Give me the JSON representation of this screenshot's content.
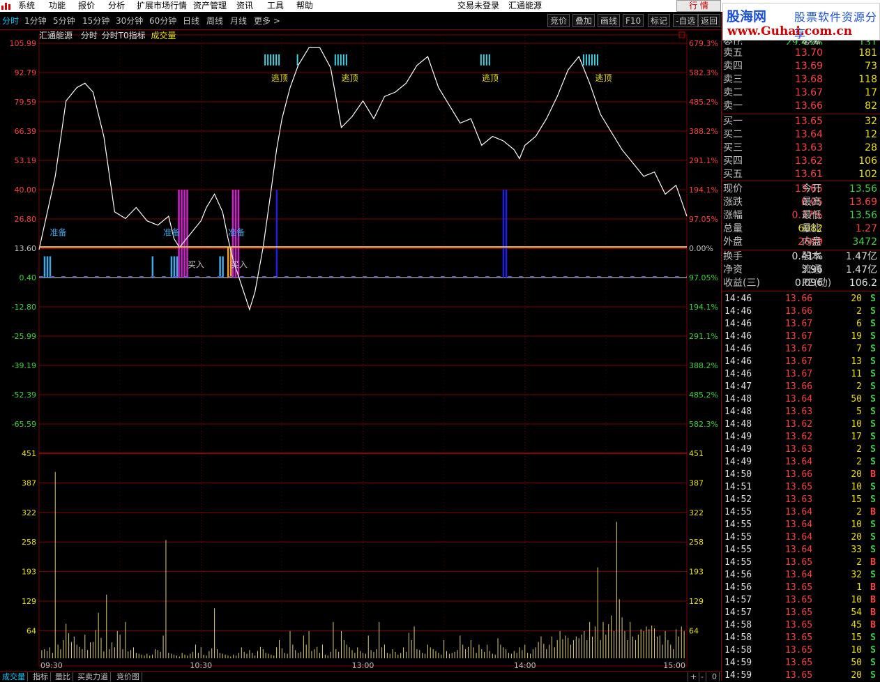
{
  "menu": {
    "items": [
      "系统",
      "功能",
      "报价",
      "分析",
      "扩展市场行情",
      "资产管理",
      "资讯",
      "工具",
      "帮助"
    ],
    "status": "交易未登录",
    "stock_name": "汇通能源",
    "hq_button": "行 情"
  },
  "periods": [
    "分时",
    "1分钟",
    "5分钟",
    "15分钟",
    "30分钟",
    "60分钟",
    "日线",
    "周线",
    "月线",
    "更多 >"
  ],
  "tool_buttons": [
    "竞价",
    "叠加",
    "画线",
    "F10",
    "标记",
    "-自选",
    "返回"
  ],
  "chart_info": {
    "name": "汇通能源",
    "mode": "分时",
    "indicator": "分时T0指标",
    "volume_label": "成交量"
  },
  "brand": {
    "name": "股海网",
    "slogan": "股票软件资源分享",
    "url": "www.Guhai.com.cn"
  },
  "order_book": {
    "top_partial": {
      "label": "委比",
      "value": "29.43%",
      "label2": "委差",
      "value2": "131"
    },
    "sell": [
      {
        "label": "卖五",
        "price": "13.70",
        "vol": "181"
      },
      {
        "label": "卖四",
        "price": "13.69",
        "vol": "73"
      },
      {
        "label": "卖三",
        "price": "13.68",
        "vol": "118"
      },
      {
        "label": "卖二",
        "price": "13.67",
        "vol": "17"
      },
      {
        "label": "卖一",
        "price": "13.66",
        "vol": "82"
      }
    ],
    "buy": [
      {
        "label": "买一",
        "price": "13.65",
        "vol": "32"
      },
      {
        "label": "买二",
        "price": "13.64",
        "vol": "12"
      },
      {
        "label": "买三",
        "price": "13.63",
        "vol": "28"
      },
      {
        "label": "买四",
        "price": "13.62",
        "vol": "106"
      },
      {
        "label": "买五",
        "price": "13.61",
        "vol": "102"
      }
    ]
  },
  "quote": [
    {
      "l1": "现价",
      "v1": "13.65",
      "c1": "red",
      "l2": "今开",
      "v2": "13.56",
      "c2": "green"
    },
    {
      "l1": "涨跌",
      "v1": "0.05",
      "c1": "red",
      "l2": "最高",
      "v2": "13.69",
      "c2": "red"
    },
    {
      "l1": "涨幅",
      "v1": "0.37%",
      "c1": "red",
      "l2": "最低",
      "v2": "13.56",
      "c2": "green"
    },
    {
      "l1": "总量",
      "v1": "6082",
      "c1": "yellow",
      "l2": "量比",
      "v2": "1.27",
      "c2": "red"
    },
    {
      "l1": "外盘",
      "v1": "2609",
      "c1": "red",
      "l2": "内盘",
      "v2": "3472",
      "c2": "green"
    }
  ],
  "fundamentals": [
    {
      "l1": "换手",
      "v1": "0.41%",
      "l2": "股本",
      "v2": "1.47亿"
    },
    {
      "l1": "净资",
      "v1": "3.96",
      "l2": "流通",
      "v2": "1.47亿"
    },
    {
      "l1": "收益(三)",
      "v1": "0.096",
      "l2": "PE(动)",
      "v2": "106.2"
    }
  ],
  "ticks": [
    {
      "t": "14:46",
      "p": "13.66",
      "v": "20",
      "s": "S"
    },
    {
      "t": "14:46",
      "p": "13.66",
      "v": "2",
      "s": "S"
    },
    {
      "t": "14:46",
      "p": "13.67",
      "v": "6",
      "s": "S"
    },
    {
      "t": "14:46",
      "p": "13.67",
      "v": "19",
      "s": "S"
    },
    {
      "t": "14:46",
      "p": "13.67",
      "v": "7",
      "s": "S"
    },
    {
      "t": "14:46",
      "p": "13.67",
      "v": "13",
      "s": "S"
    },
    {
      "t": "14:46",
      "p": "13.67",
      "v": "11",
      "s": "S"
    },
    {
      "t": "14:47",
      "p": "13.66",
      "v": "2",
      "s": "S"
    },
    {
      "t": "14:48",
      "p": "13.64",
      "v": "50",
      "s": "S"
    },
    {
      "t": "14:48",
      "p": "13.63",
      "v": "5",
      "s": "S"
    },
    {
      "t": "14:48",
      "p": "13.62",
      "v": "10",
      "s": "S"
    },
    {
      "t": "14:49",
      "p": "13.62",
      "v": "17",
      "s": "S"
    },
    {
      "t": "14:49",
      "p": "13.63",
      "v": "2",
      "s": "S"
    },
    {
      "t": "14:49",
      "p": "13.64",
      "v": "2",
      "s": "S"
    },
    {
      "t": "14:50",
      "p": "13.66",
      "v": "20",
      "s": "B"
    },
    {
      "t": "14:51",
      "p": "13.65",
      "v": "10",
      "s": "S"
    },
    {
      "t": "14:52",
      "p": "13.63",
      "v": "15",
      "s": "S"
    },
    {
      "t": "14:55",
      "p": "13.64",
      "v": "2",
      "s": "B"
    },
    {
      "t": "14:55",
      "p": "13.64",
      "v": "10",
      "s": "S"
    },
    {
      "t": "14:55",
      "p": "13.64",
      "v": "20",
      "s": "S"
    },
    {
      "t": "14:55",
      "p": "13.64",
      "v": "33",
      "s": "S"
    },
    {
      "t": "14:55",
      "p": "13.65",
      "v": "2",
      "s": "B"
    },
    {
      "t": "14:56",
      "p": "13.64",
      "v": "32",
      "s": "S"
    },
    {
      "t": "14:56",
      "p": "13.65",
      "v": "1",
      "s": "B"
    },
    {
      "t": "14:57",
      "p": "13.65",
      "v": "10",
      "s": "B"
    },
    {
      "t": "14:57",
      "p": "13.65",
      "v": "54",
      "s": "B"
    },
    {
      "t": "14:58",
      "p": "13.65",
      "v": "45",
      "s": "B"
    },
    {
      "t": "14:58",
      "p": "13.65",
      "v": "15",
      "s": "S"
    },
    {
      "t": "14:58",
      "p": "13.65",
      "v": "10",
      "s": "S"
    },
    {
      "t": "14:59",
      "p": "13.65",
      "v": "50",
      "s": "S"
    },
    {
      "t": "14:59",
      "p": "13.65",
      "v": "20",
      "s": "S"
    }
  ],
  "bottom_tabs": [
    "成交量",
    "指标",
    "量比",
    "买卖力道",
    "竞价图"
  ],
  "bottom_right": [
    "+",
    "-",
    "0"
  ],
  "chart_data": [
    {
      "type": "line",
      "title": "",
      "x_ticks": [
        "09:30",
        "10:30",
        "13:00",
        "14:00",
        "15:00"
      ],
      "y_ticks_left": [
        "105.99",
        "92.79",
        "79.59",
        "66.39",
        "53.19",
        "40.00",
        "26.80",
        "13.60",
        "0.40",
        "-12.80",
        "-25.99",
        "-39.19",
        "-52.39",
        "-65.59"
      ],
      "y_ticks_right": [
        "679.3%",
        "582.3%",
        "485.2%",
        "388.2%",
        "291.1%",
        "194.1%",
        "97.05%",
        "0.00%",
        "97.05%",
        "194.1%",
        "291.1%",
        "388.2%",
        "485.2%",
        "582.3%"
      ],
      "ylim": [
        -72.19,
        112.59
      ],
      "baseline": 13.6,
      "series": [
        {
          "name": "",
          "color": "#ffffff",
          "x": [
            0,
            6,
            10,
            14,
            17,
            20,
            24,
            28,
            32,
            36,
            40,
            44,
            48,
            50,
            52,
            56,
            60,
            62,
            65,
            68,
            70,
            72,
            75,
            78,
            80,
            83,
            86,
            88,
            90,
            93,
            96,
            100,
            104,
            108,
            112,
            116,
            120,
            124,
            128,
            132,
            136,
            140,
            144,
            148,
            152,
            156,
            160,
            164,
            168,
            172,
            176,
            178,
            180,
            184,
            188,
            192,
            196,
            200,
            204,
            208,
            212,
            216,
            220,
            224,
            228,
            232,
            236,
            240
          ],
          "y": [
            13,
            46,
            80,
            86,
            88,
            84,
            64,
            30,
            27,
            32,
            26,
            24,
            28,
            18,
            14,
            20,
            26,
            32,
            38,
            30,
            18,
            8,
            -3,
            -14,
            -6,
            14,
            40,
            58,
            72,
            86,
            96,
            104,
            104,
            95,
            68,
            73,
            80,
            72,
            82,
            84,
            88,
            96,
            100,
            86,
            78,
            70,
            72,
            60,
            64,
            62,
            58,
            54,
            60,
            64,
            72,
            82,
            94,
            100,
            88,
            74,
            66,
            58,
            52,
            46,
            48,
            38,
            42,
            28
          ]
        },
        {
          "name": "",
          "color": "#e0c060",
          "x": [
            0,
            240
          ],
          "y": [
            14.2,
            14.2
          ]
        }
      ],
      "annotations": [
        {
          "text": "准备",
          "x": 4,
          "y": 19.5,
          "color": "#3fa9e8"
        },
        {
          "text": "准备",
          "x": 46,
          "y": 19.5,
          "color": "#3fa9e8"
        },
        {
          "text": "准备",
          "x": 70,
          "y": 19.5,
          "color": "#3fa9e8"
        },
        {
          "text": "逃顶",
          "x": 86,
          "y": 89,
          "color": "#e8e000"
        },
        {
          "text": "逃顶",
          "x": 112,
          "y": 89,
          "color": "#e8e000"
        },
        {
          "text": "逃顶",
          "x": 164,
          "y": 89,
          "color": "#e8e000"
        },
        {
          "text": "逃顶",
          "x": 206,
          "y": 89,
          "color": "#e8e000"
        },
        {
          "text": "买入",
          "x": 55,
          "y": 5,
          "color": "#c0c0c0"
        },
        {
          "text": "买入",
          "x": 71,
          "y": 5,
          "color": "#c0c0c0"
        }
      ],
      "bars": [
        {
          "x": 52,
          "y0": 0.4,
          "y1": 40,
          "color": "#d020d0",
          "width": 4
        },
        {
          "x": 72,
          "y0": 0.4,
          "y1": 40,
          "color": "#d020d0",
          "width": 3
        },
        {
          "x": 88,
          "y0": 0.4,
          "y1": 40,
          "color": "#2020e0",
          "width": 1
        },
        {
          "x": 172,
          "y0": 0.4,
          "y1": 40,
          "color": "#2020e0",
          "width": 2
        },
        {
          "x": 2,
          "y0": 0.4,
          "y1": 10,
          "color": "#3fa9e8",
          "width": 3
        },
        {
          "x": 42,
          "y0": 0.4,
          "y1": 10,
          "color": "#3fa9e8",
          "width": 1
        },
        {
          "x": 49,
          "y0": 0.4,
          "y1": 10,
          "color": "#3fa9e8",
          "width": 3
        },
        {
          "x": 67,
          "y0": 0.4,
          "y1": 10,
          "color": "#3fa9e8",
          "width": 2
        },
        {
          "x": 70,
          "y0": 0.4,
          "y1": 14,
          "color": "#f0a020",
          "width": 2
        },
        {
          "x": 84,
          "y0": 96,
          "y1": 101,
          "color": "#40d0e0",
          "width": 6
        },
        {
          "x": 96,
          "y0": 96,
          "y1": 101,
          "color": "#40d0e0",
          "width": 1
        },
        {
          "x": 110,
          "y0": 96,
          "y1": 101,
          "color": "#40d0e0",
          "width": 5
        },
        {
          "x": 164,
          "y0": 96,
          "y1": 101,
          "color": "#40d0e0",
          "width": 4
        },
        {
          "x": 202,
          "y0": 96,
          "y1": 101,
          "color": "#40d0e0",
          "width": 6
        }
      ]
    },
    {
      "type": "bar",
      "title": "",
      "y_ticks": [
        "451",
        "387",
        "322",
        "258",
        "193",
        "129",
        "64"
      ],
      "ylim": [
        0,
        451
      ],
      "x": [
        1,
        2,
        3,
        4,
        5,
        6,
        7,
        8,
        9,
        10,
        11,
        12,
        13,
        14,
        15,
        16,
        17,
        18,
        19,
        20,
        21,
        22,
        23,
        24,
        25,
        26,
        27,
        28,
        29,
        30,
        31,
        32,
        33,
        34,
        35,
        36,
        37,
        38,
        39,
        40,
        41,
        42,
        43,
        44,
        45,
        46,
        47,
        48,
        49,
        50,
        51,
        52,
        53,
        54,
        55,
        56,
        57,
        58,
        59,
        60,
        61,
        62,
        63,
        64,
        65,
        66,
        67,
        68,
        69,
        70,
        71,
        72,
        73,
        74,
        75,
        76,
        77,
        78,
        79,
        80,
        81,
        82,
        83,
        84,
        85,
        86,
        87,
        88,
        89,
        90,
        91,
        92,
        93,
        94,
        95,
        96,
        97,
        98,
        99,
        100,
        101,
        102,
        103,
        104,
        105,
        106,
        107,
        108,
        109,
        110,
        111,
        112,
        113,
        114,
        115,
        116,
        117,
        118,
        119,
        120,
        121,
        122,
        123,
        124,
        125,
        126,
        127,
        128,
        129,
        130,
        131,
        132,
        133,
        134,
        135,
        136,
        137,
        138,
        139,
        140,
        141,
        142,
        143,
        144,
        145,
        146,
        147,
        148,
        149,
        150,
        151,
        152,
        153,
        154,
        155,
        156,
        157,
        158,
        159,
        160,
        161,
        162,
        163,
        164,
        165,
        166,
        167,
        168,
        169,
        170,
        171,
        172,
        173,
        174,
        175,
        176,
        177,
        178,
        179,
        180,
        181,
        182,
        183,
        184,
        185,
        186,
        187,
        188,
        189,
        190,
        191,
        192,
        193,
        194,
        195,
        196,
        197,
        198,
        199,
        200,
        201,
        202,
        203,
        204,
        205,
        206,
        207,
        208,
        209,
        210,
        211,
        212,
        213,
        214,
        215,
        216,
        217,
        218,
        219,
        220,
        221,
        222,
        223,
        224,
        225,
        226,
        227,
        228,
        229,
        230,
        231,
        232,
        233,
        234,
        235,
        236,
        237,
        238,
        239
      ],
      "values": [
        18,
        20,
        16,
        24,
        12,
        410,
        30,
        20,
        40,
        76,
        55,
        36,
        48,
        30,
        25,
        20,
        52,
        18,
        35,
        36,
        62,
        100,
        45,
        15,
        140,
        20,
        35,
        24,
        60,
        52,
        20,
        80,
        15,
        18,
        24,
        12,
        10,
        8,
        6,
        10,
        6,
        8,
        20,
        18,
        14,
        50,
        260,
        12,
        10,
        8,
        6,
        4,
        12,
        8,
        6,
        10,
        14,
        30,
        12,
        24,
        8,
        6,
        16,
        22,
        110,
        20,
        12,
        10,
        8,
        6,
        4,
        8,
        6,
        12,
        24,
        14,
        10,
        18,
        12,
        6,
        16,
        25,
        20,
        12,
        10,
        8,
        6,
        24,
        40,
        22,
        12,
        10,
        60,
        30,
        18,
        12,
        14,
        50,
        30,
        60,
        16,
        20,
        25,
        12,
        30,
        8,
        6,
        14,
        80,
        20,
        14,
        60,
        40,
        30,
        24,
        18,
        12,
        24,
        16,
        12,
        10,
        50,
        18,
        14,
        20,
        80,
        24,
        30,
        12,
        10,
        20,
        14,
        8,
        12,
        24,
        14,
        56,
        40,
        70,
        20,
        18,
        12,
        10,
        30,
        24,
        20,
        16,
        12,
        8,
        40,
        16,
        10,
        12,
        14,
        18,
        50,
        30,
        20,
        25,
        40,
        24,
        12,
        30,
        20,
        14,
        30,
        16,
        10,
        8,
        44,
        30,
        24,
        20,
        12,
        10,
        16,
        12,
        24,
        18,
        30,
        12,
        10,
        20,
        24,
        36,
        48,
        32,
        20,
        30,
        48,
        24,
        40,
        60,
        42,
        50,
        45,
        30,
        40,
        48,
        44,
        52,
        60,
        40,
        80,
        48,
        70,
        200,
        40,
        80,
        52,
        75,
        94,
        60,
        300,
        130,
        90,
        60,
        40,
        80,
        48,
        40,
        52,
        64,
        60,
        70,
        64,
        72,
        66,
        48,
        50,
        30,
        60,
        40,
        30,
        20,
        64,
        48,
        70,
        60,
        52,
        68,
        40,
        64
      ]
    }
  ]
}
